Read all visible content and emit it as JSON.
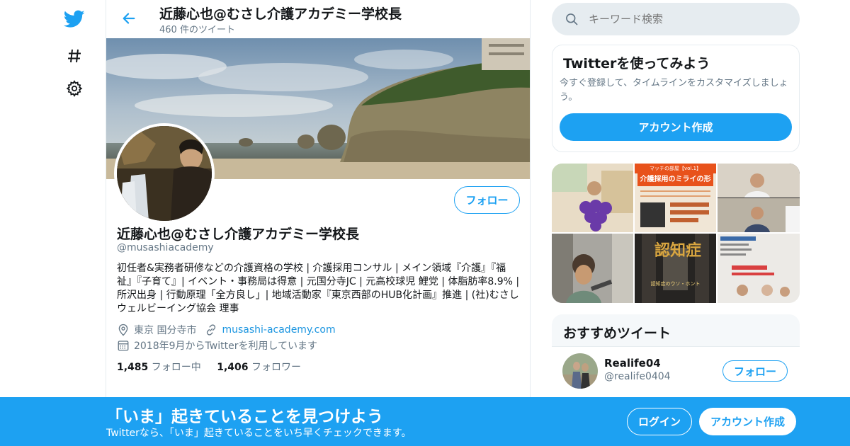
{
  "nav": {
    "icons": [
      "twitter-bird-icon",
      "hashtag-icon",
      "settings-gear-icon"
    ]
  },
  "header": {
    "title": "近藤心也@むさし介護アカデミー学校長",
    "tweet_count": "460 件のツイート"
  },
  "profile": {
    "name": "近藤心也@むさし介護アカデミー学校長",
    "handle": "@musashiacademy",
    "follow_label": "フォロー",
    "bio": "初任者&実務者研修などの介護資格の学校 | 介護採用コンサル | メイン領域『介護』『福祉』『子育て』| イベント・事務局は得意 | 元国分寺JC | 元高校球児 鯉党 | 体脂肪率8.9% | 所沢出身 | 行動原理「全方良し」| 地域活動家『東京西部のHUB化計画』推進 | (社)むさしウェルビーイング協会 理事",
    "location": "東京 国分寺市",
    "website": "musashi-academy.com",
    "joined": "2018年9月からTwitterを利用しています",
    "following_count": "1,485",
    "following_label": "フォロー中",
    "followers_count": "1,406",
    "followers_label": "フォロワー"
  },
  "search": {
    "placeholder": "キーワード検索"
  },
  "signup_card": {
    "title": "Twitterを使ってみよう",
    "text": "今すぐ登録して、タイムラインをカスタマイズしましょう。",
    "button": "アカウント作成"
  },
  "media_grid": {
    "cell_2_title": "介護採用のミライの形",
    "cell_2_top": "マッチの部屋【vol.1】",
    "cell_5_title": "認知症",
    "cell_5_sub": "認知症のウソ・ホント"
  },
  "recommended": {
    "title": "おすすめツイート",
    "users": [
      {
        "name": "Realife04",
        "handle": "@realife0404",
        "follow_label": "フォロー"
      }
    ]
  },
  "bottom_bar": {
    "title": "「いま」起きていることを見つけよう",
    "subtitle": "Twitterなら、「いま」起きていることをいち早くチェックできます。",
    "login": "ログイン",
    "signup": "アカウント作成"
  },
  "colors": {
    "brand_blue": "#1da1f2",
    "link_blue": "#1b95e0",
    "muted_gray": "#657786",
    "border_gray": "#e6ecf0"
  }
}
